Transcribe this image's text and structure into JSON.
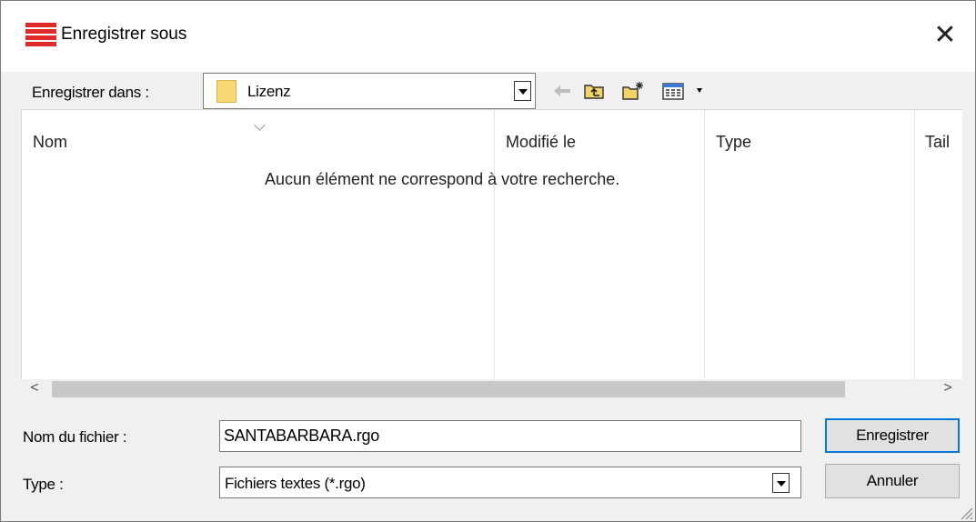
{
  "window": {
    "title": "Enregistrer sous",
    "close_glyph": "✕",
    "accent_color": "#e02a2a"
  },
  "toolbar": {
    "look_in_label": "Enregistrer dans :",
    "current_folder": "Lizenz",
    "icons": [
      "back-arrow-icon",
      "up-folder-icon",
      "new-folder-icon",
      "view-menu-icon"
    ]
  },
  "file_list": {
    "columns": [
      "Nom",
      "Modifié le",
      "Type",
      "Tail"
    ],
    "empty_message": "Aucun élément ne correspond à votre recherche."
  },
  "scrollbar": {
    "left_glyph": "<",
    "right_glyph": ">"
  },
  "form": {
    "filename_label": "Nom du fichier :",
    "filename_value": "SANTABARBARA.rgo",
    "type_label": "Type :",
    "type_value": "Fichiers textes (*.rgo)"
  },
  "buttons": {
    "save": "Enregistrer",
    "cancel": "Annuler"
  }
}
